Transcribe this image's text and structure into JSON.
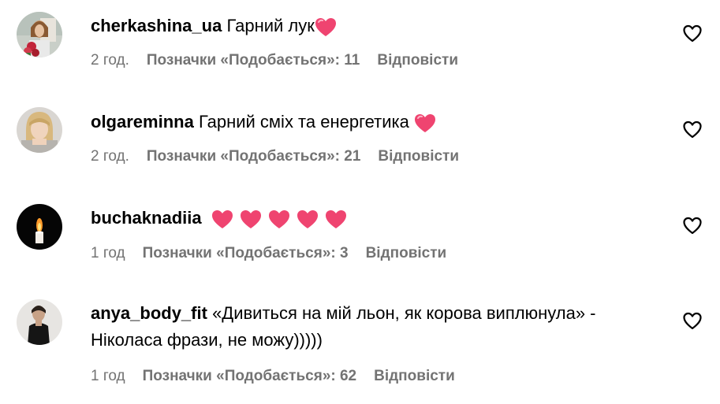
{
  "comments": [
    {
      "username": "cherkashina_ua",
      "text": "Гарний лук",
      "hearts": 1,
      "time": "2 год.",
      "likes": "Позначки «Подобається»: 11",
      "reply": "Відповісти"
    },
    {
      "username": "olgareminna",
      "text": "Гарний сміх та енергетика ",
      "hearts": 1,
      "time": "2 год.",
      "likes": "Позначки «Подобається»: 21",
      "reply": "Відповісти"
    },
    {
      "username": "buchaknadiia",
      "text": "",
      "hearts": 5,
      "time": "1 год",
      "likes": "Позначки «Подобається»: 3",
      "reply": "Відповісти"
    },
    {
      "username": "anya_body_fit",
      "text": "«Дивиться на мій льон, як корова виплюнула» - Ніколаса фрази, не можу)))))",
      "hearts": 0,
      "time": "1 год",
      "likes": "Позначки «Подобається»: 62",
      "reply": "Відповісти"
    }
  ],
  "icons": {
    "heart_emoji": "heart-emoji",
    "like": "heart-outline-icon"
  },
  "colors": {
    "meta_text": "#737373",
    "heart_emoji": "#ef4470"
  }
}
